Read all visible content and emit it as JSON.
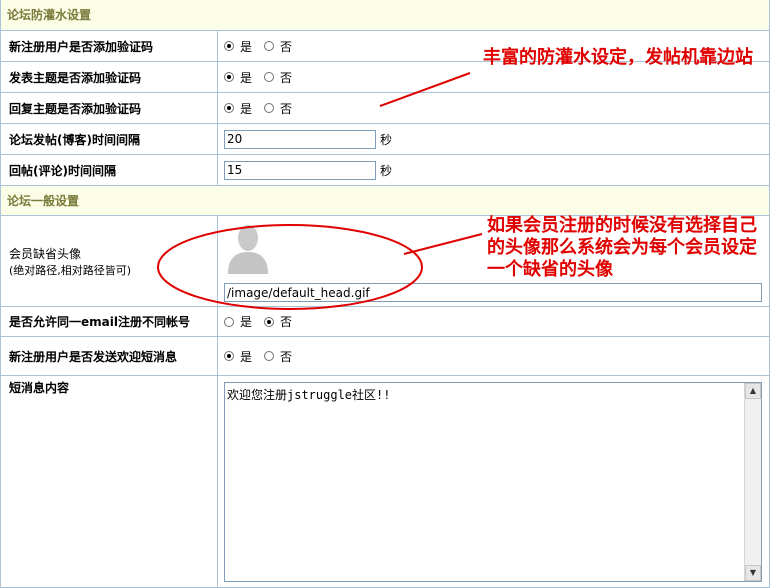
{
  "section_anti_flood": {
    "title": "论坛防灌水设置"
  },
  "rows": {
    "new_user_captcha": {
      "label": "新注册用户是否添加验证码",
      "yes": "是",
      "no": "否"
    },
    "post_captcha": {
      "label": "发表主题是否添加验证码",
      "yes": "是",
      "no": "否"
    },
    "reply_captcha": {
      "label": "回复主题是否添加验证码",
      "yes": "是",
      "no": "否"
    },
    "post_interval": {
      "label": "论坛发帖(博客)时间间隔",
      "value": "20",
      "unit": "秒"
    },
    "reply_interval": {
      "label": "回帖(评论)时间间隔",
      "value": "15",
      "unit": "秒"
    }
  },
  "section_general": {
    "title": "论坛一般设置"
  },
  "avatar": {
    "label": "会员缺省头像",
    "sublabel": "(绝对路径,相对路径皆可)",
    "path": "/image/default_head.gif"
  },
  "email_dup": {
    "label": "是否允许同一email注册不同帐号",
    "yes": "是",
    "no": "否"
  },
  "welcome_msg": {
    "label": "新注册用户是否发送欢迎短消息",
    "yes": "是",
    "no": "否"
  },
  "msg_content": {
    "label": "短消息内容",
    "text": "欢迎您注册jstruggle社区!!"
  },
  "annotations": {
    "anti_flood": "丰富的防灌水设定，发帖机靠边站",
    "avatar": "如果会员注册的时候没有选择自己的头像那么系统会为每个会员设定一个缺省的头像"
  },
  "colors": {
    "section_bg": "#fbfde6",
    "border": "#a9c3d9",
    "annotation": "#e00000"
  }
}
